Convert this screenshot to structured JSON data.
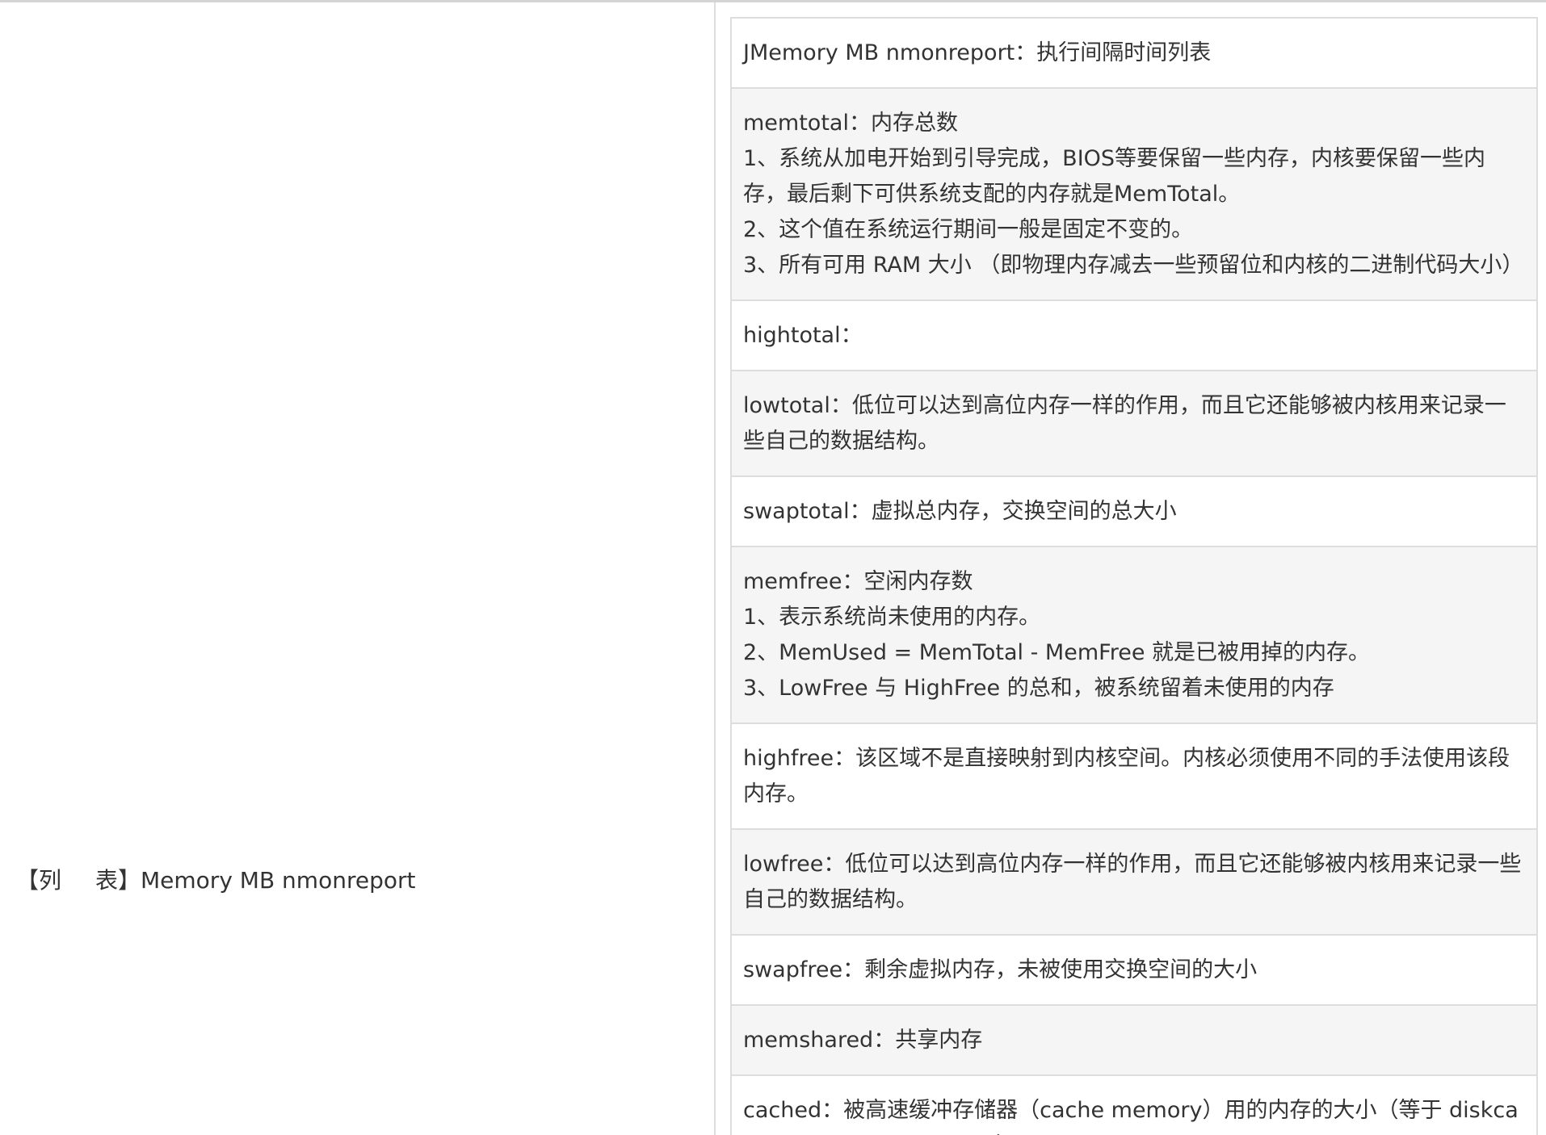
{
  "row_label": {
    "bracket_open": "【列",
    "bracket_close": "表】Memory MB nmonreport"
  },
  "items": [
    {
      "lines": [
        "JMemory MB nmonreport：执行间隔时间列表"
      ]
    },
    {
      "lines": [
        "memtotal：内存总数",
        "1、系统从加电开始到引导完成，BIOS等要保留一些内存，内核要保留一些内存，最后剩下可供系统支配的内存就是MemTotal。",
        "2、这个值在系统运行期间一般是固定不变的。",
        "3、所有可用 RAM 大小 （即物理内存减去一些预留位和内核的二进制代码大小）"
      ]
    },
    {
      "lines": [
        "hightotal："
      ]
    },
    {
      "lines": [
        "lowtotal：低位可以达到高位内存一样的作用，而且它还能够被内核用来记录一些自己的数据结构。"
      ]
    },
    {
      "lines": [
        "swaptotal：虚拟总内存，交换空间的总大小"
      ]
    },
    {
      "lines": [
        "memfree：空闲内存数",
        "1、表示系统尚未使用的内存。",
        "2、MemUsed = MemTotal - MemFree 就是已被用掉的内存。",
        "3、LowFree 与 HighFree 的总和，被系统留着未使用的内存"
      ]
    },
    {
      "lines": [
        "highfree：该区域不是直接映射到内核空间。内核必须使用不同的手法使用该段内存。"
      ]
    },
    {
      "lines": [
        "lowfree：低位可以达到高位内存一样的作用，而且它还能够被内核用来记录一些自己的数据结构。"
      ]
    },
    {
      "lines": [
        "swapfree：剩余虚拟内存，未被使用交换空间的大小"
      ]
    },
    {
      "lines": [
        "memshared：共享内存"
      ]
    },
    {
      "lines": [
        "cached：被高速缓冲存储器（cache memory）用的内存的大小（等于 diskcache minus SwapCache ）"
      ]
    }
  ]
}
